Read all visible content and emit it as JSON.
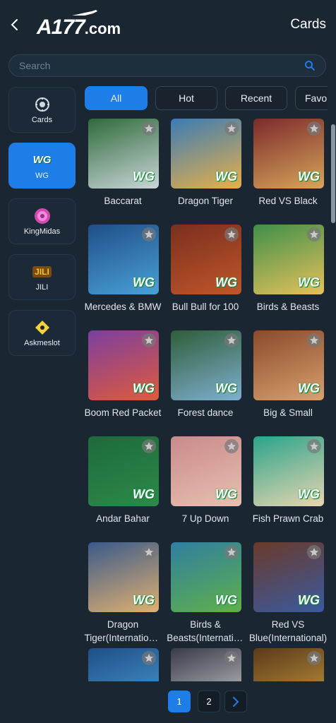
{
  "header": {
    "logo_main": "A177",
    "logo_suffix": ".com",
    "title": "Cards"
  },
  "search": {
    "placeholder": "Search",
    "value": ""
  },
  "sidebar": {
    "items": [
      {
        "label": "Cards",
        "icon": "poker-chip-icon",
        "active": false
      },
      {
        "label": "WG",
        "icon": "wg-logo-icon",
        "active": true
      },
      {
        "label": "KingMidas",
        "icon": "kingmidas-chip-icon",
        "active": false
      },
      {
        "label": "JILI",
        "icon": "jili-logo-icon",
        "active": false
      },
      {
        "label": "Askmeslot",
        "icon": "askmeslot-logo-icon",
        "active": false
      }
    ]
  },
  "tabs": [
    {
      "label": "All",
      "active": true
    },
    {
      "label": "Hot",
      "active": false
    },
    {
      "label": "Recent",
      "active": false
    },
    {
      "label": "Favo",
      "active": false
    }
  ],
  "games": [
    {
      "name": "Baccarat",
      "bg": [
        "#2f6b3a",
        "#c9d6d9"
      ]
    },
    {
      "name": "Dragon Tiger",
      "bg": [
        "#3b7bb5",
        "#e7b04a"
      ]
    },
    {
      "name": "Red VS Black",
      "bg": [
        "#7a2b2b",
        "#d9a45a"
      ]
    },
    {
      "name": "Mercedes & BMW",
      "bg": [
        "#1f4f86",
        "#4aa0d8"
      ]
    },
    {
      "name": "Bull Bull for 100",
      "bg": [
        "#7a2f1e",
        "#c0562a"
      ]
    },
    {
      "name": "Birds & Beasts",
      "bg": [
        "#3f8f4a",
        "#e6c15a"
      ]
    },
    {
      "name": "Boom Red Packet",
      "bg": [
        "#7c3fa0",
        "#e05a3a"
      ]
    },
    {
      "name": "Forest dance",
      "bg": [
        "#2f5d3a",
        "#7fb0d0"
      ]
    },
    {
      "name": "Big & Small",
      "bg": [
        "#8a4a2a",
        "#d9a070"
      ]
    },
    {
      "name": "Andar Bahar",
      "bg": [
        "#1d6a3a",
        "#2c8a4a"
      ]
    },
    {
      "name": "7 Up Down",
      "bg": [
        "#c98a8a",
        "#e8c0b0"
      ]
    },
    {
      "name": "Fish Prawn Crab",
      "bg": [
        "#2aa38a",
        "#e8d6b0"
      ]
    },
    {
      "name": "Dragon Tiger(International)",
      "bg": [
        "#3a5a8a",
        "#e0b070"
      ]
    },
    {
      "name": "Birds & Beasts(International)",
      "bg": [
        "#2f7fa0",
        "#5fb04a"
      ]
    },
    {
      "name": "Red VS Blue(International)",
      "bg": [
        "#6a3a2a",
        "#3a5aa0"
      ]
    },
    {
      "name": "",
      "bg": [
        "#1f4f86",
        "#4aa0d8"
      ]
    },
    {
      "name": "",
      "bg": [
        "#3a3a4a",
        "#d6d6d6"
      ]
    },
    {
      "name": "",
      "bg": [
        "#5a3a1a",
        "#d0a040"
      ]
    }
  ],
  "pagination": {
    "pages": [
      "1",
      "2"
    ],
    "current": "1",
    "next_icon": "chevron-right-icon"
  },
  "colors": {
    "background": "#1a2733",
    "accent": "#1e7ee8",
    "panel": "#1c2a37"
  }
}
